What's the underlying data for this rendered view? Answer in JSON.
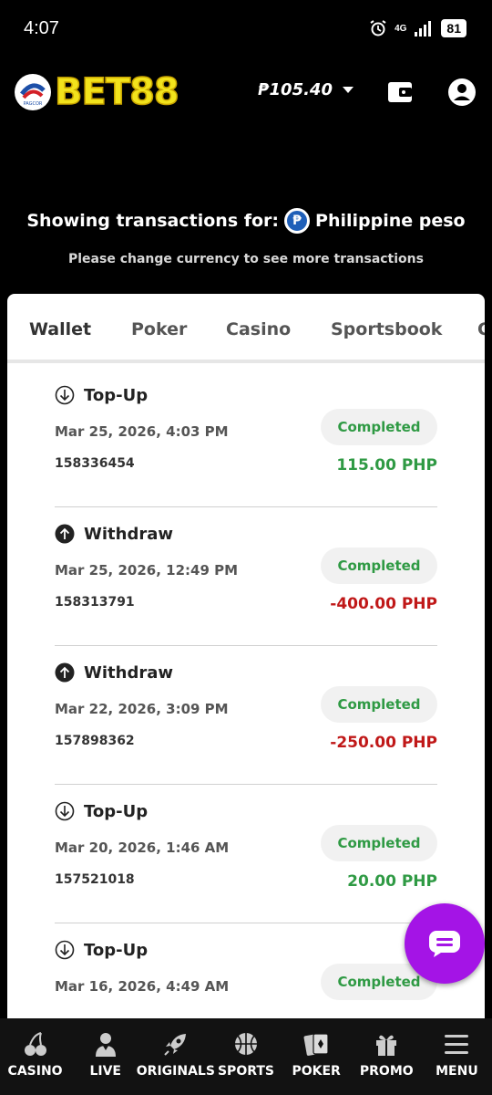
{
  "status_bar": {
    "time": "4:07",
    "network": "4G",
    "battery": "81"
  },
  "header": {
    "logo_text": "BET88",
    "pagcor_text": "PAGCOR",
    "balance": "₱105.40"
  },
  "intro": {
    "showing_label": "Showing transactions for:",
    "currency_symbol": "₱",
    "currency_name": "Philippine peso",
    "note": "Please change currency to see more transactions"
  },
  "tabs": [
    {
      "label": "Wallet",
      "active": true
    },
    {
      "label": "Poker"
    },
    {
      "label": "Casino"
    },
    {
      "label": "Sportsbook"
    },
    {
      "label": "C"
    }
  ],
  "transactions": [
    {
      "type": "Top-Up",
      "direction": "down",
      "date": "Mar 25, 2026, 4:03 PM",
      "id": "158336454",
      "status": "Completed",
      "amount": "115.00 PHP",
      "sign": "pos"
    },
    {
      "type": "Withdraw",
      "direction": "up",
      "date": "Mar 25, 2026, 12:49 PM",
      "id": "158313791",
      "status": "Completed",
      "amount": "-400.00 PHP",
      "sign": "neg"
    },
    {
      "type": "Withdraw",
      "direction": "up",
      "date": "Mar 22, 2026, 3:09 PM",
      "id": "157898362",
      "status": "Completed",
      "amount": "-250.00 PHP",
      "sign": "neg"
    },
    {
      "type": "Top-Up",
      "direction": "down",
      "date": "Mar 20, 2026, 1:46 AM",
      "id": "157521018",
      "status": "Completed",
      "amount": "20.00 PHP",
      "sign": "pos"
    },
    {
      "type": "Top-Up",
      "direction": "down",
      "date": "Mar 16, 2026, 4:49 AM",
      "id": "",
      "status": "Completed",
      "amount": "",
      "sign": "pos"
    }
  ],
  "bottom_nav": [
    {
      "label": "CASINO",
      "icon": "cherries-icon"
    },
    {
      "label": "LIVE",
      "icon": "dealer-icon"
    },
    {
      "label": "ORIGINALS",
      "icon": "rocket-icon"
    },
    {
      "label": "SPORTS",
      "icon": "basketball-icon"
    },
    {
      "label": "POKER",
      "icon": "cards-icon"
    },
    {
      "label": "PROMO",
      "icon": "gift-icon"
    },
    {
      "label": "MENU",
      "icon": "hamburger-icon"
    }
  ],
  "colors": {
    "accent": "#6a1fb0",
    "chat": "#a414e6",
    "positive": "#2f9a44",
    "negative": "#c01818",
    "logo": "#f2e31c"
  }
}
